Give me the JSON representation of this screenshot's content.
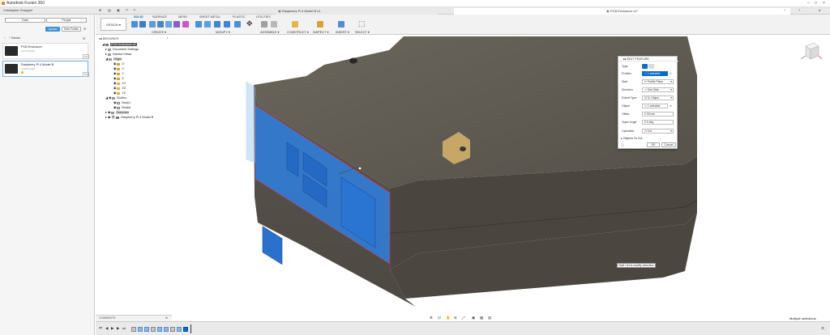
{
  "app": {
    "title": "Autodesk Fusion 360"
  },
  "tabs": {
    "left": "Raspberry Pi 4 Model B v1",
    "right": "PCB Enclosure v2*"
  },
  "data_panel": {
    "user": "Christopher Chappell",
    "segments": [
      "Data",
      "People"
    ],
    "upload_label": "Upload",
    "new_folder_label": "New Folder",
    "breadcrumb": "Tutorial",
    "files": [
      {
        "name": "PCB Enclosure",
        "time": "11:47:25 AM",
        "version": "V2"
      },
      {
        "name": "Raspberry Pi 4 Model B",
        "time": "11:32:21 AM",
        "version": "V1"
      }
    ]
  },
  "toolbar": {
    "workspace": "DESIGN",
    "tabs": [
      "SOLID",
      "SURFACE",
      "MESH",
      "SHEET METAL",
      "PLASTIC",
      "UTILITIES"
    ],
    "groups": [
      "CREATE",
      "MODIFY",
      "ASSEMBLE",
      "CONSTRUCT",
      "INSPECT",
      "INSERT",
      "SELECT"
    ]
  },
  "browser": {
    "header": "BROWSER",
    "root": "PCB Enclosure v2",
    "items": [
      "Document Settings",
      "Named Views",
      "Origin",
      "O",
      "X",
      "Y",
      "Z",
      "XY",
      "XZ",
      "YZ",
      "Bodies",
      "Body1",
      "Body6",
      "Sketches",
      "Raspberry Pi 4 Model B"
    ]
  },
  "dialog": {
    "title": "EDIT FEATURE",
    "rows": [
      {
        "label": "Type",
        "value": ""
      },
      {
        "label": "Profiles",
        "value": "1 selected"
      },
      {
        "label": "Start",
        "value": "Profile Plane"
      },
      {
        "label": "Direction",
        "value": "One Side"
      },
      {
        "label": "Extent Type",
        "value": "To Object"
      },
      {
        "label": "Object",
        "value": "1 selected"
      },
      {
        "label": "Offset",
        "value": "0.00 mm"
      },
      {
        "label": "Taper Angle",
        "value": "0.0 deg"
      },
      {
        "label": "Operation",
        "value": "Cut"
      }
    ],
    "objects_to_cut": "Objects To Cut",
    "ok_label": "OK",
    "cancel_label": "Cancel"
  },
  "hint": "Hold Ctrl to modify selection",
  "comments_label": "COMMENTS",
  "status": "Multiple selections",
  "colors": {
    "accent": "#0a6cc7",
    "body": "#56524a",
    "selection": "#2f7fe0"
  }
}
